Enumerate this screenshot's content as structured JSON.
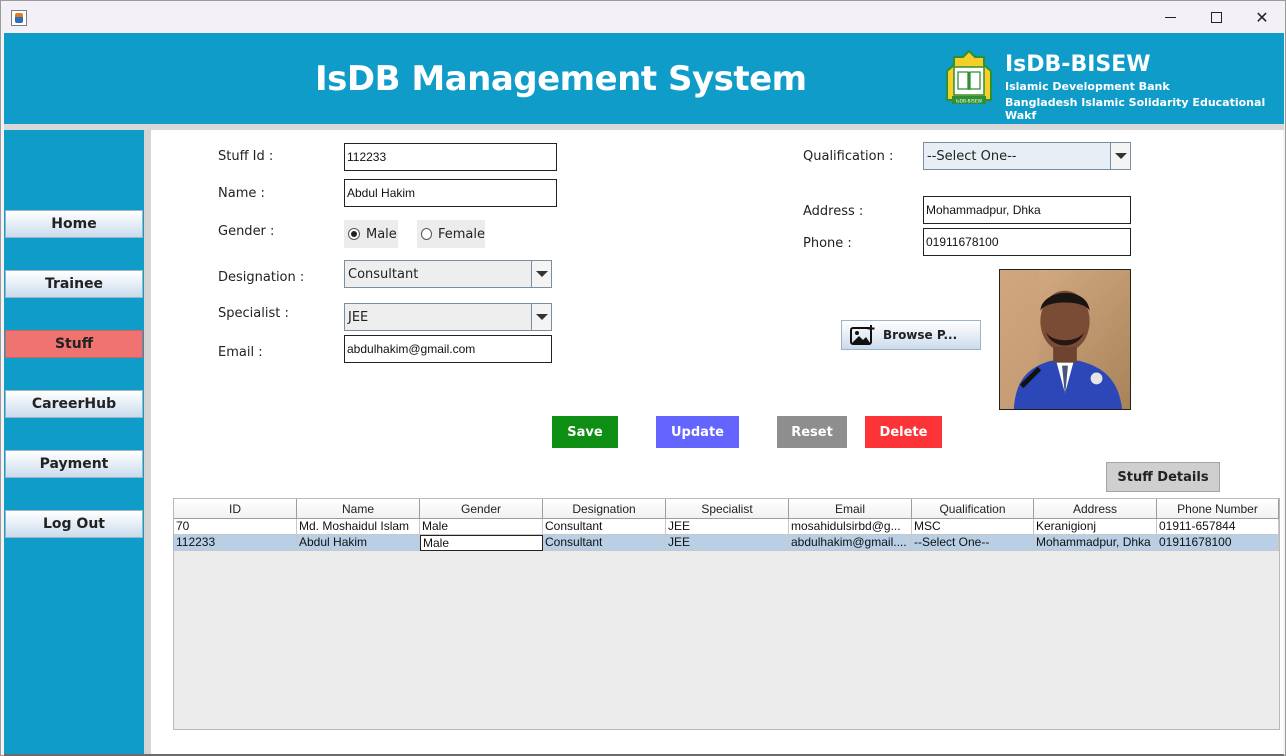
{
  "window": {
    "title_icon": "java-app-icon",
    "min_icon": "minimize-icon",
    "max_icon": "maximize-icon",
    "close_glyph": "✕"
  },
  "header": {
    "title": "IsDB Management System",
    "org_name": "IsDB-BISEW",
    "org_line1": "Islamic Development Bank",
    "org_line2": "Bangladesh Islamic Solidarity Educational Wakf",
    "logo_caption": "IsDB-BISEW"
  },
  "sidebar": {
    "items": [
      {
        "label": "Home"
      },
      {
        "label": "Trainee"
      },
      {
        "label": "Stuff"
      },
      {
        "label": "CareerHub"
      },
      {
        "label": "Payment"
      },
      {
        "label": "Log Out"
      }
    ],
    "active": "Stuff"
  },
  "form": {
    "stuff_id_label": "Stuff Id :",
    "stuff_id_value": "112233",
    "name_label": "Name :",
    "name_value": "Abdul Hakim",
    "gender_label": "Gender :",
    "gender_male": "Male",
    "gender_female": "Female",
    "gender_selected": "Male",
    "designation_label": "Designation :",
    "designation_value": "Consultant",
    "specialist_label": "Specialist :",
    "specialist_value": "JEE",
    "email_label": "Email :",
    "email_value": "abdulhakim@gmail.com",
    "qualification_label": "Qualification :",
    "qualification_value": "--Select One--",
    "address_label": "Address :",
    "address_value": "Mohammadpur, Dhka",
    "phone_label": "Phone :",
    "phone_value": "01911678100",
    "browse_label": "Browse P...",
    "browse_icon": "add-image-icon"
  },
  "actions": {
    "save": "Save",
    "update": "Update",
    "reset": "Reset",
    "delete": "Delete",
    "details": "Stuff Details"
  },
  "colors": {
    "header_bg": "#0f9cc9",
    "active_nav": "#ef7370",
    "save": "#0e8e12",
    "update": "#6464ff",
    "reset": "#8e8e8e",
    "delete": "#fd3437"
  },
  "table": {
    "columns": [
      "ID",
      "Name",
      "Gender",
      "Designation",
      "Specialist",
      "Email",
      "Qualification",
      "Address",
      "Phone Number"
    ],
    "rows": [
      [
        "70",
        "Md. Moshaidul Islam",
        "Male",
        "Consultant",
        "JEE",
        "mosahidulsirbd@g...",
        "MSC",
        "Keranigionj",
        "01911-657844"
      ],
      [
        "112233",
        "Abdul Hakim",
        "Male",
        "Consultant",
        "JEE",
        "abdulhakim@gmail....",
        "--Select One--",
        "Mohammadpur, Dhka",
        "01911678100"
      ]
    ],
    "selected_row": 1
  }
}
